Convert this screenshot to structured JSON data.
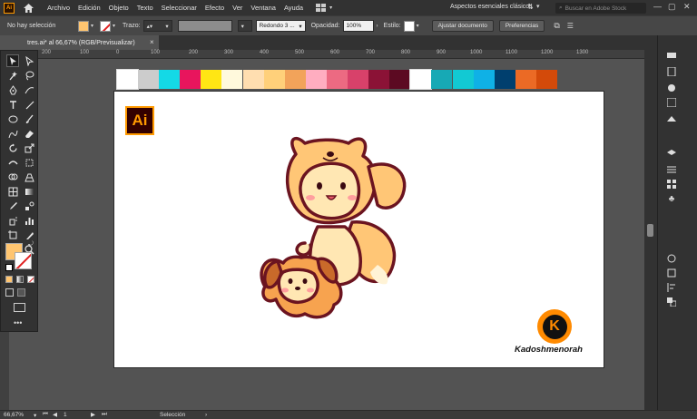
{
  "app": {
    "logo_text": "Ai"
  },
  "menu": {
    "items": [
      "Archivo",
      "Edición",
      "Objeto",
      "Texto",
      "Seleccionar",
      "Efecto",
      "Ver",
      "Ventana",
      "Ayuda"
    ],
    "workspace": "Aspectos esenciales clásicos",
    "stock_search_placeholder": "Buscar en Adobe Stock"
  },
  "control_bar": {
    "selection_status": "No hay selección",
    "fill_color": "#ffc570",
    "stroke_label": "Trazo:",
    "brush_label": "Redondo 3 ...",
    "opacity_label": "Opacidad:",
    "opacity_value": "100%",
    "style_label": "Estilo:",
    "document_button": "Ajustar documento",
    "preferences_button": "Preferencias"
  },
  "document_tab": {
    "title": "tres.ai* al 66,67% (RGB/Previsualizar)",
    "close": "×"
  },
  "ruler": {
    "ticks": [
      "200",
      "100",
      "0",
      "100",
      "200",
      "300",
      "400",
      "500",
      "600",
      "700",
      "800",
      "900",
      "1000",
      "1100",
      "1200",
      "1300"
    ]
  },
  "palette": {
    "colors": [
      "#ffffff",
      "#cccccc",
      "#14d9e6",
      "#e8155d",
      "#ffe614",
      "#fff9dc",
      "#ffdeb0",
      "#ffd07a",
      "#f2a35a",
      "#ffadc0",
      "#ec6a82",
      "#d8416a",
      "#8b1236",
      "#5c0a22",
      "#ffffff",
      "#17a9b5",
      "#12c9d3",
      "#0fb1e6",
      "#003f6e",
      "#eb6a25",
      "#d34a0a"
    ]
  },
  "artboard": {
    "ai_logo_text": "Ai",
    "watermark_name": "Kadoshmenorah",
    "watermark_letter": "K"
  },
  "colors": {
    "fill": "#ffc570",
    "character_light": "#ffe7b3",
    "character_mid": "#ffc676",
    "outline": "#6b1420",
    "dog_body": "#f7a34f",
    "blush": "#ff8c98",
    "watermark_orange": "#ff8a00"
  },
  "status_bar": {
    "zoom": "66,67%",
    "page": "1",
    "tool": "Selección"
  }
}
